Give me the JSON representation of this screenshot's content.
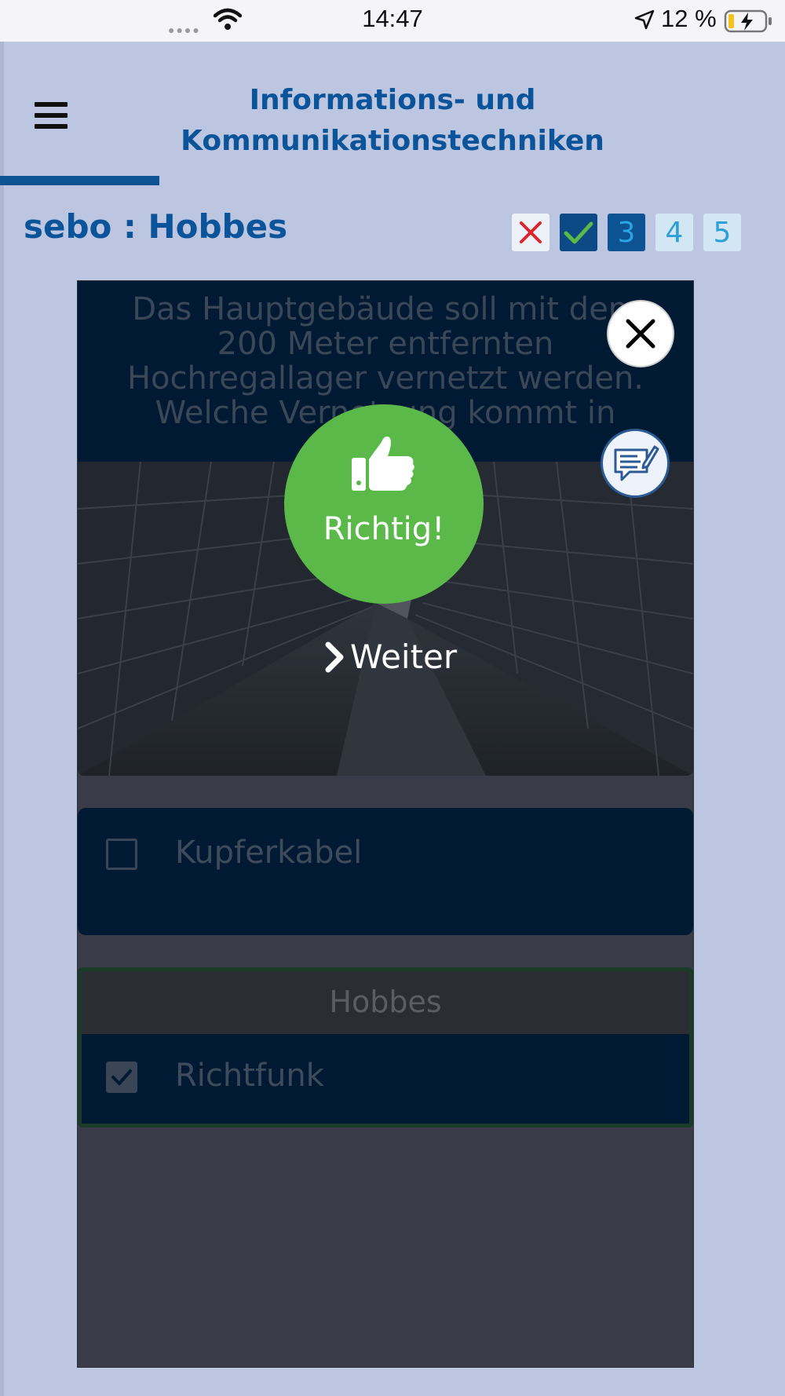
{
  "status_bar": {
    "time": "14:47",
    "battery": "12 %"
  },
  "header": {
    "title_line1": "Informations- und",
    "title_line2": "Kommunikationstechniken",
    "menu_icon": "hamburger-menu-icon"
  },
  "match": {
    "player": "sebo",
    "separator": " : ",
    "opponent": "Hobbes"
  },
  "rounds": [
    {
      "state": "lost",
      "icon": "cross-icon"
    },
    {
      "state": "won",
      "icon": "check-icon"
    },
    {
      "state": "current",
      "label": "3"
    },
    {
      "state": "pending",
      "label": "4"
    },
    {
      "state": "pending",
      "label": "5"
    }
  ],
  "question": {
    "text": "Das Hauptgebäude soll mit dem 200 Meter entfernten Hochregallager vernetzt werden. Welche Vernetzung kommt in Frage?"
  },
  "answers": [
    {
      "label": "Kupferkabel",
      "checked": false
    },
    {
      "label": "Richtfunk",
      "checked": true,
      "chosen_by": "Hobbes"
    }
  ],
  "result": {
    "label": "Richtig!",
    "icon": "thumbs-up-icon",
    "color": "#5ab949"
  },
  "next": {
    "label": "Weiter"
  },
  "colors": {
    "brand_blue": "#0b5499",
    "background": "#bcc6e1",
    "card_dark": "#001a33",
    "success": "#5ab949"
  }
}
